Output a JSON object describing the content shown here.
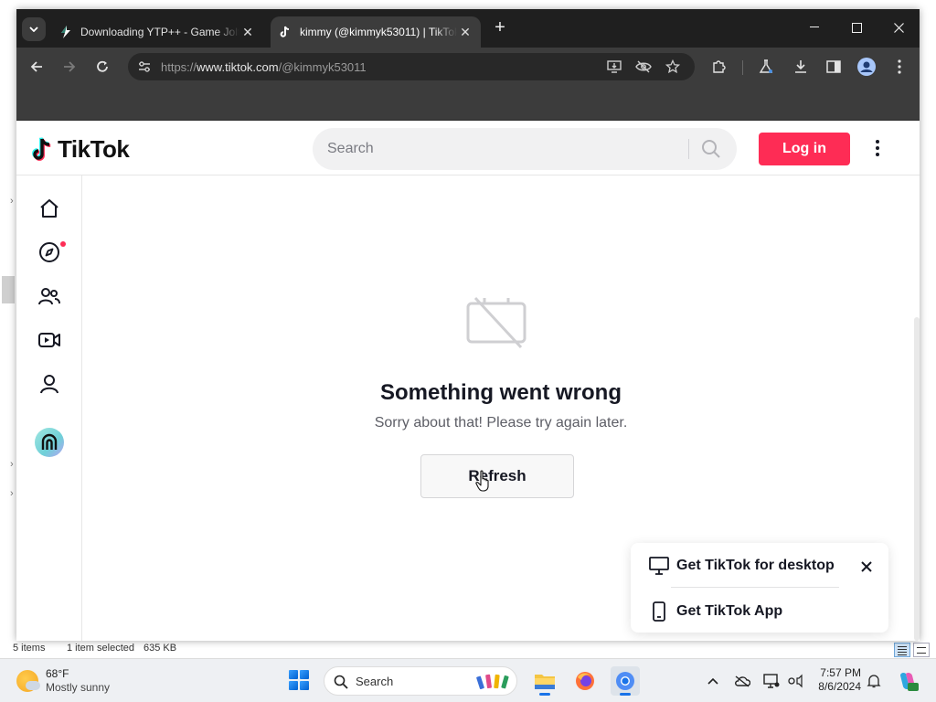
{
  "browser": {
    "tabs": [
      {
        "title": "Downloading YTP++ - Game Jolt",
        "active": false
      },
      {
        "title": "kimmy (@kimmyk53011) | TikTok",
        "active": true
      }
    ],
    "url_prefix": "https://",
    "url_host": "www.tiktok.com",
    "url_path": "/@kimmyk53011"
  },
  "tiktok": {
    "logo_text": "TikTok",
    "search_placeholder": "Search",
    "login_label": "Log in",
    "error": {
      "title": "Something went wrong",
      "subtitle": "Sorry about that! Please try again later.",
      "button": "Refresh"
    },
    "promo": {
      "desktop": "Get TikTok for desktop",
      "app": "Get TikTok App"
    },
    "sidebar_items": [
      "home",
      "explore",
      "following",
      "live",
      "profile",
      "avatar"
    ]
  },
  "explorer_status": {
    "items": "5 items",
    "selected": "1 item selected",
    "size": "635 KB"
  },
  "taskbar": {
    "temp": "68°F",
    "condition": "Mostly sunny",
    "search_label": "Search",
    "time": "7:57 PM",
    "date": "8/6/2024"
  },
  "colors": {
    "tiktok_red": "#fe2c55",
    "chrome_dark": "#1f1f1f",
    "chrome_toolbar": "#3c3c3c"
  }
}
